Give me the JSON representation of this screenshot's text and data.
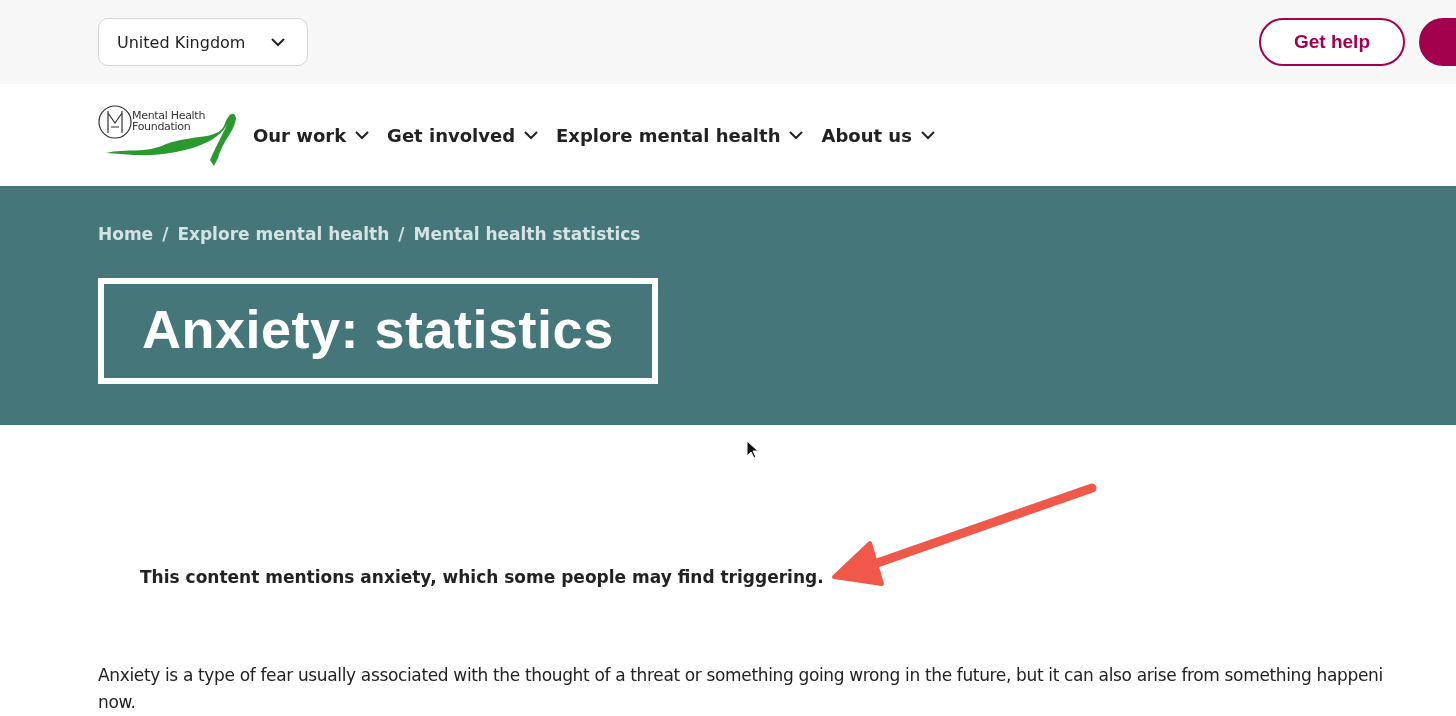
{
  "top_bar": {
    "country": "United Kingdom",
    "get_help": "Get help"
  },
  "logo": {
    "text": "Mental Health Foundation"
  },
  "nav": [
    {
      "label": "Our work"
    },
    {
      "label": "Get involved"
    },
    {
      "label": "Explore mental health"
    },
    {
      "label": "About us"
    }
  ],
  "breadcrumb": [
    "Home",
    "Explore mental health",
    "Mental health statistics"
  ],
  "breadcrumb_separator": "/",
  "title": "Anxiety: statistics",
  "content_warning": "This content mentions anxiety, which some people may find triggering.",
  "paragraph_lines": [
    "Anxiety is a type of fear usually associated with the thought of a threat or something going wrong in the future, but it can also arise from something happeni",
    "now."
  ]
}
